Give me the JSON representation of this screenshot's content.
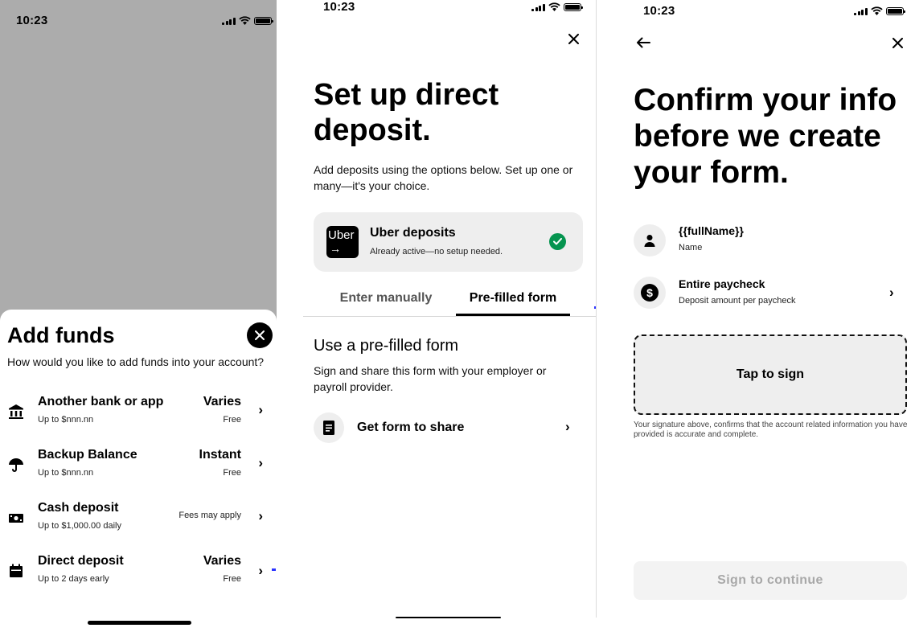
{
  "status_bar": {
    "time": "10:23"
  },
  "add_funds": {
    "title": "Add funds",
    "subtitle": "How would you like to add funds into your account?",
    "options": [
      {
        "icon": "bank-icon",
        "title": "Another bank or app",
        "subtitle": "Up to $nnn.nn",
        "right_title": "Varies",
        "right_subtitle": "Free"
      },
      {
        "icon": "umbrella-icon",
        "title": "Backup Balance",
        "subtitle": "Up to $nnn.nn",
        "right_title": "Instant",
        "right_subtitle": "Free"
      },
      {
        "icon": "cash-icon",
        "title": "Cash deposit",
        "subtitle": "Up to $1,000.00 daily",
        "right_note": "Fees may apply"
      },
      {
        "icon": "calendar-icon",
        "title": "Direct deposit",
        "subtitle": "Up to 2 days early",
        "right_title": "Varies",
        "right_subtitle": "Free"
      }
    ]
  },
  "direct_deposit": {
    "title": "Set up direct deposit.",
    "description": "Add deposits using the options below. Set up one or many—it's your choice.",
    "uber_card": {
      "logo_text": "Uber",
      "title": "Uber deposits",
      "subtitle": "Already active—no setup needed."
    },
    "tabs": [
      {
        "label": "Enter manually",
        "active": false
      },
      {
        "label": "Pre-filled form",
        "active": true
      }
    ],
    "section_title": "Use a pre-filled form",
    "section_description": "Sign and share this form with your employer or payroll provider.",
    "share_label": "Get form to share"
  },
  "confirm": {
    "title": "Confirm your info before we create your form.",
    "rows": [
      {
        "title": "{{fullName}}",
        "subtitle": "Name"
      },
      {
        "title": "Entire paycheck",
        "subtitle": "Deposit amount per paycheck"
      }
    ],
    "sign_label": "Tap to sign",
    "disclaimer": "Your signature above, confirms that the account related information you have provided is accurate and complete.",
    "cta_label": "Sign to continue"
  },
  "colors": {
    "success": "#05944f",
    "scrim": "#acacac",
    "card": "#eeeeee",
    "disabled_text": "#a8a8a8"
  }
}
